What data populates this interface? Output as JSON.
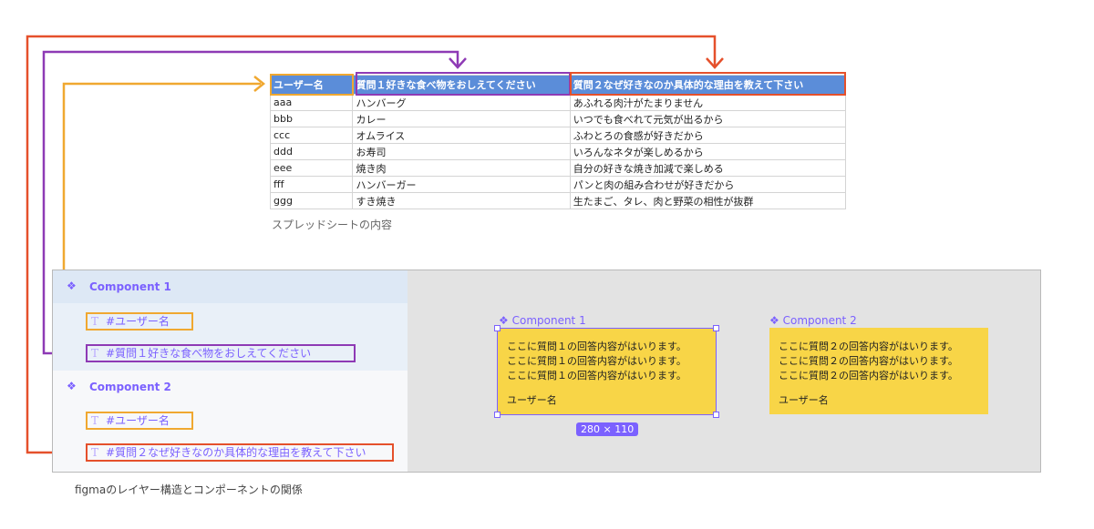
{
  "spreadsheet": {
    "headers": [
      "ユーザー名",
      "質問１好きな食べ物をおしえてください",
      "質問２なぜ好きなのか具体的な理由を教えて下さい"
    ],
    "rows": [
      [
        "aaa",
        "ハンバーグ",
        "あふれる肉汁がたまりません"
      ],
      [
        "bbb",
        "カレー",
        "いつでも食べれて元気が出るから"
      ],
      [
        "ccc",
        "オムライス",
        "ふわとろの食感が好きだから"
      ],
      [
        "ddd",
        "お寿司",
        "いろんなネタが楽しめるから"
      ],
      [
        "eee",
        "焼き肉",
        "自分の好きな焼き加減で楽しめる"
      ],
      [
        "fff",
        "ハンバーガー",
        "パンと肉の組み合わせが好きだから"
      ],
      [
        "ggg",
        "すき焼き",
        "生たまご、タレ、肉と野菜の相性が抜群"
      ]
    ],
    "caption": "スプレッドシートの内容"
  },
  "figma": {
    "caption": "figmaのレイヤー構造とコンポーネントの関係",
    "layers": {
      "component1": "Component 1",
      "c1_user": "#ユーザー名",
      "c1_q1": "#質問１好きな食べ物をおしえてください",
      "component2": "Component 2",
      "c2_user": "#ユーザー名",
      "c2_q2": "#質問２なぜ好きなのか具体的な理由を教えて下さい"
    },
    "canvas": {
      "card1_label": "Component 1",
      "card1_line": "ここに質問１の回答内容がはいります。",
      "card1_user": "ユーザー名",
      "card2_label": "Component 2",
      "card2_line": "ここに質問２の回答内容がはいります。",
      "card2_user": "ユーザー名",
      "dimensions": "280 × 110"
    }
  },
  "colors": {
    "orange": "#f0a830",
    "purple": "#8e3ab5",
    "red": "#e5502b",
    "figma_purple": "#7b61ff",
    "header_blue": "#5b8dd9",
    "card_yellow": "#f8d547"
  },
  "icons": {
    "component": "component-diamond-icon",
    "text": "text-layer-icon"
  }
}
